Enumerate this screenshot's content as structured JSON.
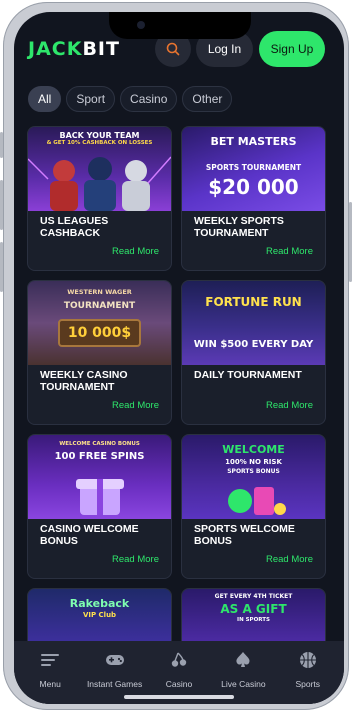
{
  "brand": {
    "logo_left": "JACK",
    "logo_right": "BIT",
    "accent": "#2ee66b"
  },
  "header": {
    "search_icon": "search-icon",
    "login_label": "Log In",
    "signup_label": "Sign Up"
  },
  "filters": [
    {
      "label": "All",
      "active": true
    },
    {
      "label": "Sport",
      "active": false
    },
    {
      "label": "Casino",
      "active": false
    },
    {
      "label": "Other",
      "active": false
    }
  ],
  "cards": [
    {
      "title": "US LEAGUES CASHBACK",
      "more": "Read More",
      "art_line1": "BACK YOUR TEAM",
      "art_line2": "& GET 10% CASHBACK ON LOSSES"
    },
    {
      "title": "WEEKLY SPORTS TOURNAMENT",
      "more": "Read More",
      "art_line1": "BET MASTERS",
      "art_line2": "SPORTS TOURNAMENT",
      "art_line3": "$20 000"
    },
    {
      "title": "WEEKLY CASINO TOURNAMENT",
      "more": "Read More",
      "art_line1": "WESTERN WAGER",
      "art_line2": "TOURNAMENT",
      "art_line3": "10 000$"
    },
    {
      "title": "DAILY TOURNAMENT",
      "more": "Read More",
      "art_line1": "FORTUNE RUN",
      "art_line2": "WIN $500 EVERY DAY"
    },
    {
      "title": "CASINO WELCOME BONUS",
      "more": "Read More",
      "art_line1": "WELCOME CASINO BONUS",
      "art_line2": "100 FREE SPINS"
    },
    {
      "title": "SPORTS WELCOME BONUS",
      "more": "Read More",
      "art_line1": "WELCOME",
      "art_line2": "100% NO RISK",
      "art_line3": "SPORTS BONUS"
    },
    {
      "title": "",
      "more": "",
      "art_line1": "Rakeback",
      "art_line2": "VIP Club"
    },
    {
      "title": "",
      "more": "",
      "art_line1": "GET EVERY 4TH TICKET",
      "art_line2": "AS A GIFT",
      "art_line3": "IN SPORTS"
    }
  ],
  "bottom_nav": [
    {
      "label": "Menu",
      "icon": "menu-icon"
    },
    {
      "label": "Instant Games",
      "icon": "gamepad-icon"
    },
    {
      "label": "Casino",
      "icon": "cherry-icon"
    },
    {
      "label": "Live Casino",
      "icon": "spade-icon"
    },
    {
      "label": "Sports",
      "icon": "ball-icon"
    }
  ]
}
